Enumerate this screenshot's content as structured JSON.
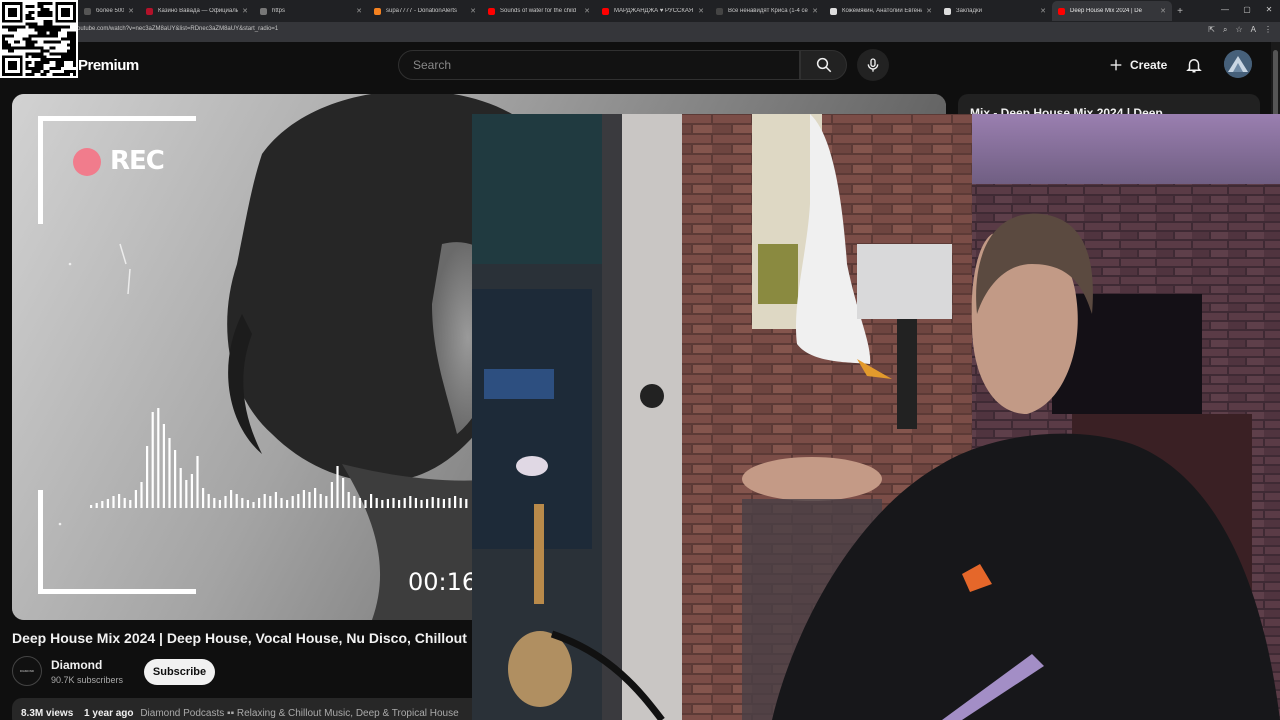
{
  "browser": {
    "tabs": [
      {
        "title": "более 500$",
        "favicon_color": "#555555"
      },
      {
        "title": "Казино Вавада — Официальн",
        "favicon_color": "#b3122a"
      },
      {
        "title": "https",
        "favicon_color": "#777777"
      },
      {
        "title": "supa7777 - DonationAlerts",
        "favicon_color": "#f58220"
      },
      {
        "title": "Sounds of water for the child",
        "favicon_color": "#ff0000"
      },
      {
        "title": "МАРДЖАНДЖА ♥ РУССКАЯ",
        "favicon_color": "#ff0000"
      },
      {
        "title": "Все ненавидят Криса (1-4 се",
        "favicon_color": "#444444"
      },
      {
        "title": "Кожемякин, Анатолий Евгени",
        "favicon_color": "#dddddd"
      },
      {
        "title": "Закладки",
        "favicon_color": "#dddddd"
      },
      {
        "title": "Deep House Mix 2024 | De",
        "favicon_color": "#ff0000",
        "active": true
      }
    ],
    "url": "youtube.com/watch?v=nec3aZM8aUY&list=RDnec3aZM8aUY&start_radio=1"
  },
  "youtube": {
    "logo_text": "Premium",
    "search_placeholder": "Search",
    "create_label": "Create",
    "accent_color": "#ff0000"
  },
  "player": {
    "rec_label": "REC",
    "timer": "00:16"
  },
  "video": {
    "title": "Deep House Mix 2024 | Deep House, Vocal House, Nu Disco, Chillout",
    "channel": {
      "name": "Diamond",
      "subscribers": "90.7K subscribers",
      "avatar_text": "DIAMOND"
    },
    "subscribe_label": "Subscribe",
    "description": {
      "views": "8.3M views",
      "age": "1 year ago",
      "tags": "Diamond Podcasts  ▪▪  Relaxing & Chillout Music, Deep & Tropical House"
    }
  },
  "sidebar": {
    "playlist_title": "Mix - Deep House Mix 2024 | Deep"
  }
}
